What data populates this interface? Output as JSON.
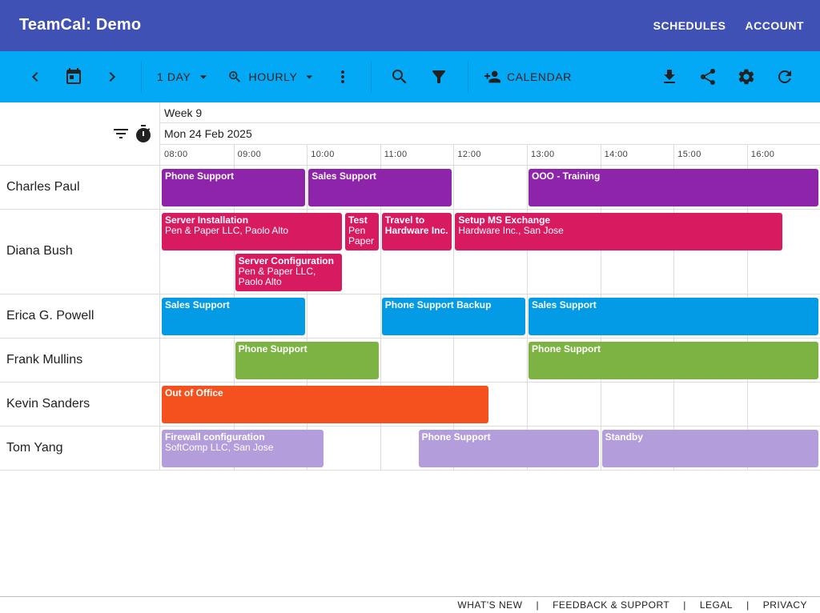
{
  "app": {
    "title": "TeamCal:  Demo",
    "nav": [
      "SCHEDULES",
      "ACCOUNT"
    ]
  },
  "toolbar": {
    "prev_icon": "chevron-left-icon",
    "today_icon": "calendar-today-icon",
    "next_icon": "chevron-right-icon",
    "range_label": "1 DAY",
    "zoom_label": "HOURLY",
    "add_calendar_label": "CALENDAR",
    "right_icons": [
      "download-icon",
      "share-icon",
      "settings-icon",
      "refresh-icon"
    ]
  },
  "header": {
    "week": "Week 9",
    "date": "Mon 24 Feb 2025",
    "hours": [
      "08:00",
      "09:00",
      "10:00",
      "11:00",
      "12:00",
      "13:00",
      "14:00",
      "15:00",
      "16:00"
    ]
  },
  "colors": {
    "purple": "#8e24aa",
    "pink": "#d81b60",
    "blue": "#039be5",
    "green": "#7cb342",
    "orange": "#f4511e",
    "lavender": "#b39ddb"
  },
  "resources": [
    {
      "name": "Charles Paul",
      "lanes": 1,
      "events": [
        {
          "title": "Phone Support",
          "start": 8,
          "end": 10,
          "color": "purple",
          "lane": 0
        },
        {
          "title": "Sales Support",
          "start": 10,
          "end": 12,
          "color": "purple",
          "lane": 0
        },
        {
          "title": "OOO - Training",
          "start": 13,
          "end": 17,
          "color": "purple",
          "lane": 0
        }
      ]
    },
    {
      "name": "Diana Bush",
      "lanes": 2,
      "events": [
        {
          "title": "Server Installation",
          "subtitle": "Pen & Paper LLC, Paolo Alto",
          "start": 8,
          "end": 10.5,
          "color": "pink",
          "lane": 0
        },
        {
          "title": "Test",
          "subtitle": "Pen Paper",
          "start": 10.5,
          "end": 11,
          "color": "pink",
          "lane": 0
        },
        {
          "title": "Travel to Hardware Inc.",
          "start": 11,
          "end": 12,
          "color": "pink",
          "lane": 0
        },
        {
          "title": "Setup MS Exchange",
          "subtitle": "Hardware Inc., San Jose",
          "start": 12,
          "end": 16.5,
          "color": "pink",
          "lane": 0
        },
        {
          "title": "Server Configuration",
          "subtitle": "Pen & Paper LLC, Paolo Alto",
          "start": 9,
          "end": 10.5,
          "color": "pink",
          "lane": 1
        }
      ]
    },
    {
      "name": "Erica G. Powell",
      "lanes": 1,
      "events": [
        {
          "title": "Sales Support",
          "start": 8,
          "end": 10,
          "color": "blue",
          "lane": 0
        },
        {
          "title": "Phone Support Backup",
          "start": 11,
          "end": 13,
          "color": "blue",
          "lane": 0
        },
        {
          "title": "Sales Support",
          "start": 13,
          "end": 17,
          "color": "blue",
          "lane": 0
        }
      ]
    },
    {
      "name": "Frank Mullins",
      "lanes": 1,
      "events": [
        {
          "title": "Phone Support",
          "start": 9,
          "end": 11,
          "color": "green",
          "lane": 0
        },
        {
          "title": "Phone Support",
          "start": 13,
          "end": 17,
          "color": "green",
          "lane": 0
        }
      ]
    },
    {
      "name": "Kevin Sanders",
      "lanes": 1,
      "events": [
        {
          "title": "Out of Office",
          "start": 8,
          "end": 12.5,
          "color": "orange",
          "lane": 0
        }
      ]
    },
    {
      "name": "Tom Yang",
      "lanes": 1,
      "events": [
        {
          "title": "Firewall configuration",
          "subtitle": "SoftComp LLC, San Jose",
          "start": 8,
          "end": 10.25,
          "color": "lavender",
          "lane": 0
        },
        {
          "title": "Phone Support",
          "start": 11.5,
          "end": 14,
          "color": "lavender",
          "lane": 0
        },
        {
          "title": "Standby",
          "start": 14,
          "end": 17,
          "color": "lavender",
          "lane": 0
        }
      ]
    }
  ],
  "footer": {
    "links": [
      "WHAT'S NEW",
      "FEEDBACK & SUPPORT",
      "LEGAL",
      "PRIVACY"
    ]
  }
}
